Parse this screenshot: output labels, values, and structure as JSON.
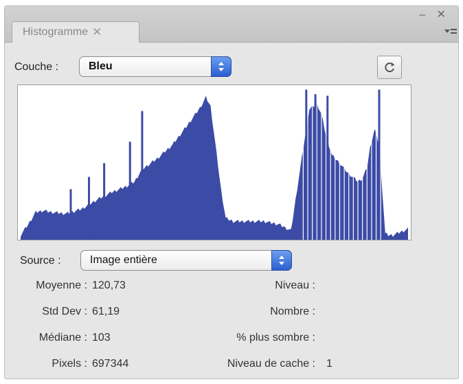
{
  "panel": {
    "tab_label": "Histogramme",
    "tab_close": "✕",
    "window_controls": "– ✕"
  },
  "channel": {
    "label": "Couche :",
    "value": "Bleu"
  },
  "refresh_icon": "refresh-icon",
  "source": {
    "label": "Source :",
    "value": "Image entière"
  },
  "stats_left": [
    {
      "key": "Moyenne :",
      "value": "120,73"
    },
    {
      "key": "Std Dev :",
      "value": "61,19"
    },
    {
      "key": "Médiane :",
      "value": "103"
    },
    {
      "key": "Pixels :",
      "value": "697344"
    }
  ],
  "stats_right": [
    {
      "key": "Niveau :",
      "value": ""
    },
    {
      "key": "Nombre :",
      "value": ""
    },
    {
      "key": "% plus sombre :",
      "value": ""
    },
    {
      "key": "Niveau de cache :",
      "value": "1"
    }
  ],
  "colors": {
    "histogram_fill": "#3c4ba6",
    "accent": "#3a6fe0"
  },
  "chart_data": {
    "type": "area",
    "x": [
      0,
      5,
      10,
      15,
      20,
      30,
      40,
      50,
      60,
      70,
      75,
      80,
      90,
      100,
      110,
      118,
      122,
      125,
      128,
      132,
      135,
      140,
      150,
      160,
      170,
      178,
      185,
      190,
      195,
      198,
      201,
      205,
      210,
      215,
      222,
      225,
      228,
      230,
      233,
      236,
      240,
      242,
      245,
      255
    ],
    "values": [
      3,
      10,
      18,
      19,
      18,
      17,
      20,
      26,
      31,
      35,
      38,
      46,
      53,
      62,
      75,
      86,
      93,
      87,
      64,
      32,
      14,
      12,
      12,
      12,
      10,
      6,
      53,
      85,
      89,
      82,
      68,
      55,
      50,
      44,
      38,
      40,
      47,
      60,
      72,
      62,
      4,
      3,
      3,
      7
    ],
    "spikes": [
      {
        "x": 33,
        "value": 33
      },
      {
        "x": 45,
        "value": 41
      },
      {
        "x": 55,
        "value": 50
      },
      {
        "x": 72,
        "value": 64
      },
      {
        "x": 80,
        "value": 84
      },
      {
        "x": 188,
        "value": 98
      },
      {
        "x": 194,
        "value": 95
      },
      {
        "x": 202,
        "value": 94
      },
      {
        "x": 236,
        "value": 98
      }
    ],
    "xlim": [
      0,
      255
    ],
    "ylim": [
      0,
      100
    ]
  }
}
